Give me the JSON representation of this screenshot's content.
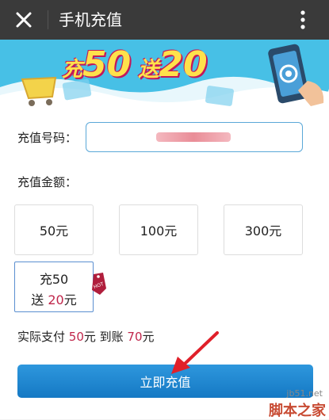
{
  "window": {
    "title": "手机充值"
  },
  "banner": {
    "text_a": "充",
    "num_a": "50",
    "text_b": "送",
    "num_b": "20"
  },
  "form": {
    "phone_label": "充值号码：",
    "amount_label": "充值金额："
  },
  "amounts": [
    "50元",
    "100元",
    "300元"
  ],
  "promo": {
    "line1": "充50",
    "line2_prefix": "送 ",
    "line2_value": "20",
    "line2_suffix": "元",
    "tag_text": "HOT"
  },
  "summary": {
    "pay_label": "实际支付 ",
    "pay_value": "50",
    "pay_unit": "元 到账 ",
    "get_value": "70",
    "get_unit": "元"
  },
  "submit_label": "立即充值",
  "watermark": {
    "site": "jb51.net",
    "brand": "脚本之家"
  },
  "colors": {
    "accent": "#1f8ad3",
    "highlight": "#c0264b",
    "topbar": "#3a3a3a"
  }
}
